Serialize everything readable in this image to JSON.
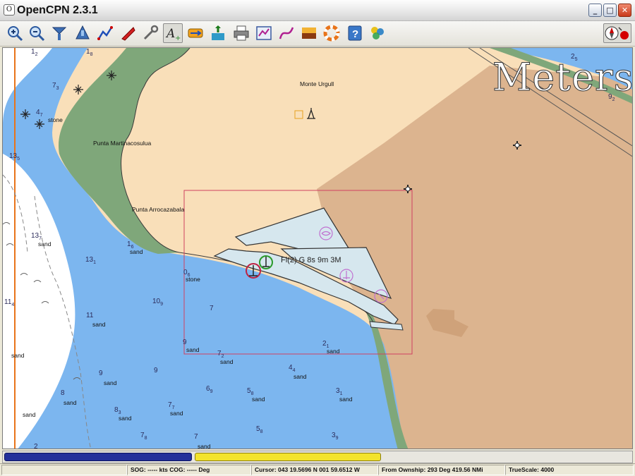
{
  "window": {
    "title": "OpenCPN 2.3.1",
    "minimize": "_",
    "maximize": "□",
    "close": "✕"
  },
  "toolbar": {
    "buttons": [
      {
        "name": "zoom-in-icon"
      },
      {
        "name": "zoom-out-icon"
      },
      {
        "name": "scale-in-icon"
      },
      {
        "name": "scale-out-icon"
      },
      {
        "name": "route-icon"
      },
      {
        "name": "follow-ship-icon"
      },
      {
        "name": "settings-icon"
      },
      {
        "name": "text-toggle-icon"
      },
      {
        "name": "current-icon"
      },
      {
        "name": "tide-icon"
      },
      {
        "name": "print-icon"
      },
      {
        "name": "route-manager-icon"
      },
      {
        "name": "track-icon"
      },
      {
        "name": "color-scheme-icon"
      },
      {
        "name": "mob-icon"
      },
      {
        "name": "help-icon"
      },
      {
        "name": "plugin-icon"
      }
    ],
    "right_button": {
      "name": "compass-north-up-icon"
    }
  },
  "chart": {
    "scale_overlay": "Meters",
    "light_label": "Fl(2) G 8s 9m 3M",
    "places": [
      {
        "text": "Monte Urgull"
      },
      {
        "text": "Punta Martinacosulua"
      },
      {
        "text": "Punta Arrocazabala"
      }
    ],
    "seabed": [
      "stone",
      "sand",
      "sand",
      "stone",
      "sand",
      "stone",
      "sand",
      "sand",
      "sand",
      "sand",
      "sand",
      "sand",
      "sand",
      "sand",
      "sand",
      "sand",
      "sand",
      "sand",
      "sand"
    ],
    "soundings": [
      {
        "v": "1",
        "s": "8"
      },
      {
        "v": "7",
        "s": "3"
      },
      {
        "v": "4",
        "s": "7"
      },
      {
        "v": "13",
        "s": "5"
      },
      {
        "v": "13",
        "s": "7"
      },
      {
        "v": "1",
        "s": "6"
      },
      {
        "v": "13",
        "s": "1"
      },
      {
        "v": "0",
        "s": "6"
      },
      {
        "v": "10",
        "s": "9"
      },
      {
        "v": "11",
        "s": ""
      },
      {
        "v": "7",
        "s": ""
      },
      {
        "v": "9",
        "s": ""
      },
      {
        "v": "11",
        "s": "4"
      },
      {
        "v": "7",
        "s": "2"
      },
      {
        "v": "4",
        "s": "4"
      },
      {
        "v": "2",
        "s": "1"
      },
      {
        "v": "6",
        "s": "9"
      },
      {
        "v": "5",
        "s": "8"
      },
      {
        "v": "3",
        "s": "1"
      },
      {
        "v": "7",
        "s": "7"
      },
      {
        "v": "8",
        "s": "3"
      },
      {
        "v": "7",
        "s": "8"
      },
      {
        "v": "5",
        "s": "8"
      },
      {
        "v": "3",
        "s": "9"
      },
      {
        "v": "7",
        "s": ""
      },
      {
        "v": "2",
        "s": "5"
      },
      {
        "v": "9",
        "s": "2"
      },
      {
        "v": "9",
        "s": ""
      },
      {
        "v": "9",
        "s": ""
      },
      {
        "v": "8",
        "s": ""
      },
      {
        "v": "1",
        "s": "2"
      },
      {
        "v": "2",
        "s": ""
      }
    ]
  },
  "status": {
    "sog_cog": "SOG: ----- kts  COG: ----- Deg",
    "cursor": "Cursor: 043 19.5696 N 001 59.6512 W",
    "from_ownship": "From Ownship: 293 Deg  419.56 NMi",
    "true_scale": "TrueScale:      4000"
  },
  "colors": {
    "land": "#f9dfb9",
    "urban": "#dcb48f",
    "shallow": "#7cb6ef",
    "deep": "#ffffff",
    "intertidal": "#7fa77a",
    "harbor": "#d6e7ee"
  }
}
